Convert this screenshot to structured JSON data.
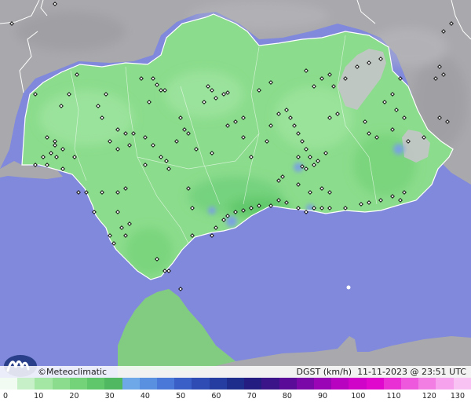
{
  "map": {
    "colors": {
      "sea": "#8089dc",
      "land_outside": "#a9a9ad",
      "region_base": "#8bdc8c",
      "region_light": "#9fe5a0",
      "region_mid": "#6fcf7a",
      "gust_blue": "#7aa3e0",
      "mountain_gray": "#c4c4c8",
      "border": "#ffffff",
      "station": "#000000"
    }
  },
  "infobar": {
    "credit": "©Meteoclimatic",
    "product": "DGST (km/h)  11-11-2023 @ 23:51 UTC"
  },
  "legend": {
    "ticks": [
      "0",
      "10",
      "20",
      "30",
      "40",
      "50",
      "60",
      "70",
      "80",
      "90",
      "100",
      "110",
      "120",
      "130"
    ],
    "colors": [
      "#f2fbf2",
      "#c8f0c8",
      "#a4e6a4",
      "#8bdc8c",
      "#74d278",
      "#60c86a",
      "#4fb860",
      "#6fa8e8",
      "#5a90e0",
      "#4a78d8",
      "#3a60c8",
      "#2e4cb4",
      "#253ca0",
      "#1e2c8c",
      "#241c80",
      "#3a1488",
      "#5a0c98",
      "#7a08a8",
      "#9a06b6",
      "#b804c0",
      "#d004c8",
      "#e008cc",
      "#e830d4",
      "#ee58dc",
      "#f27ee4",
      "#f6a2ec",
      "#f8c2f2"
    ]
  }
}
